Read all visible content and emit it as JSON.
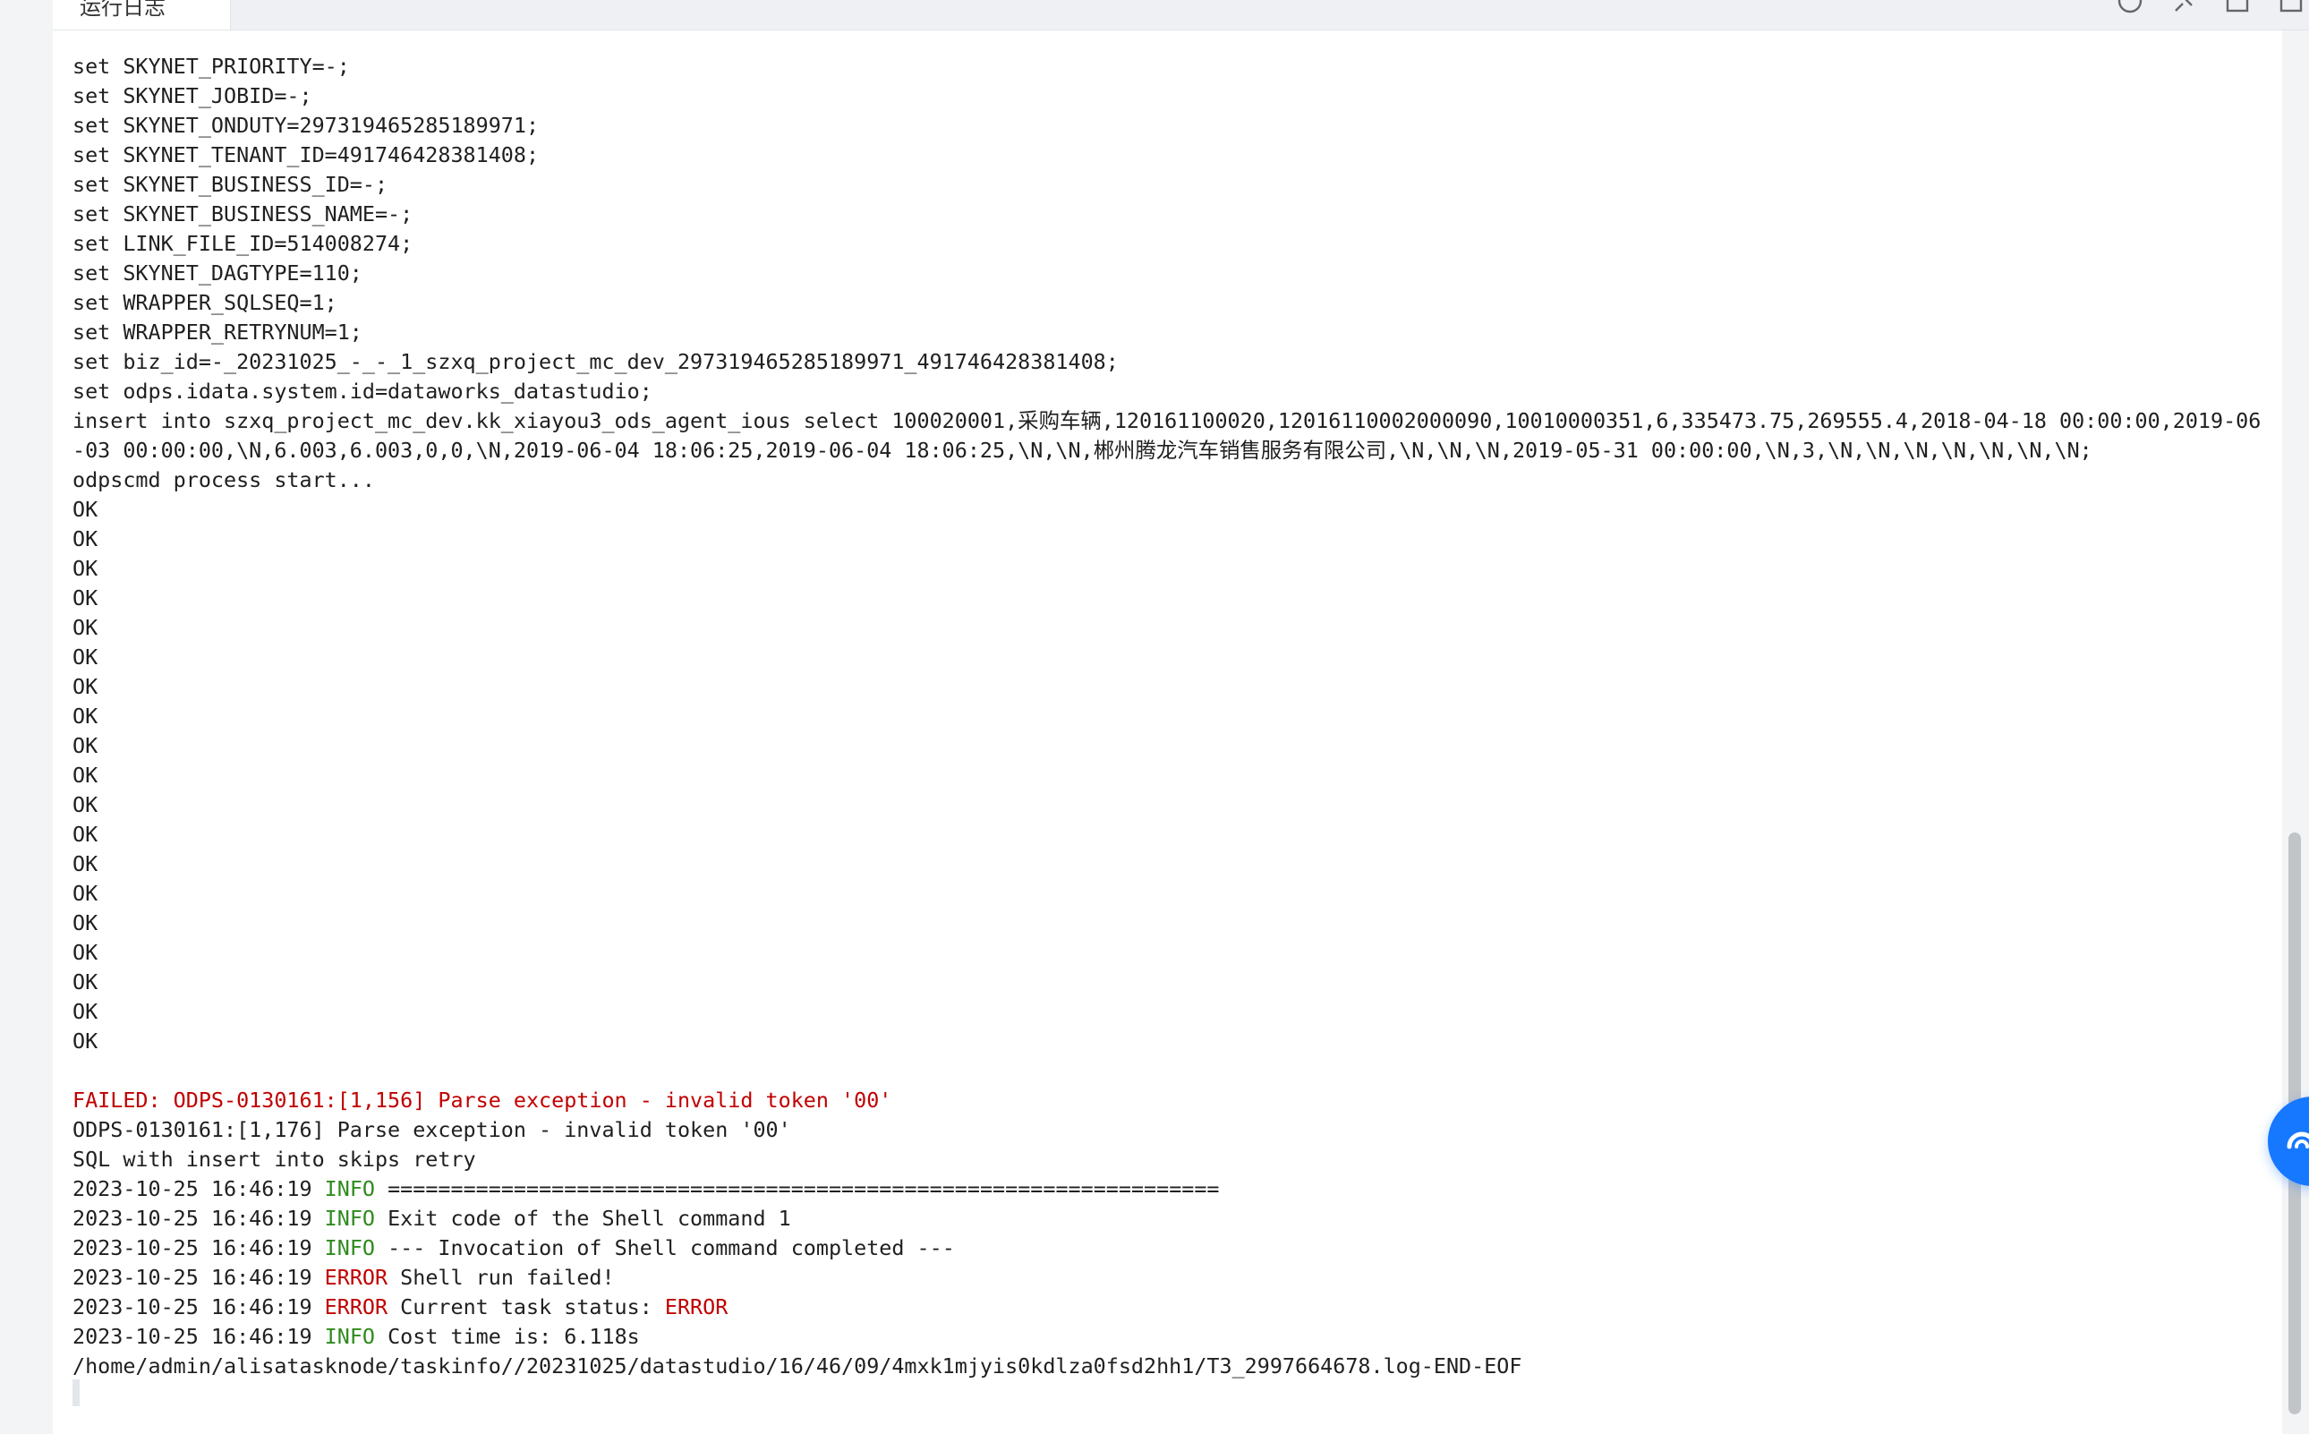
{
  "tab": {
    "label": "运行日志"
  },
  "toolbar": {
    "icons": [
      "refresh-icon",
      "pin-icon",
      "expand-icon",
      "close-icon"
    ]
  },
  "log": {
    "lines": [
      {
        "text": "set SKYNET_PRIORITY=-;"
      },
      {
        "text": "set SKYNET_JOBID=-;"
      },
      {
        "text": "set SKYNET_ONDUTY=297319465285189971;"
      },
      {
        "text": "set SKYNET_TENANT_ID=491746428381408;"
      },
      {
        "text": "set SKYNET_BUSINESS_ID=-;"
      },
      {
        "text": "set SKYNET_BUSINESS_NAME=-;"
      },
      {
        "text": "set LINK_FILE_ID=514008274;"
      },
      {
        "text": "set SKYNET_DAGTYPE=110;"
      },
      {
        "text": "set WRAPPER_SQLSEQ=1;"
      },
      {
        "text": "set WRAPPER_RETRYNUM=1;"
      },
      {
        "text": "set biz_id=-_20231025_-_-_1_szxq_project_mc_dev_297319465285189971_491746428381408;"
      },
      {
        "text": "set odps.idata.system.id=dataworks_datastudio;"
      },
      {
        "text": "insert into szxq_project_mc_dev.kk_xiayou3_ods_agent_ious select 100020001,采购车辆,120161100020,12016110002000090,10010000351,6,335473.75,269555.4,2018-04-18 00:00:00,2019-06-03 00:00:00,\\N,6.003,6.003,0,0,\\N,2019-06-04 18:06:25,2019-06-04 18:06:25,\\N,\\N,郴州腾龙汽车销售服务有限公司,\\N,\\N,\\N,2019-05-31 00:00:00,\\N,3,\\N,\\N,\\N,\\N,\\N,\\N,\\N;"
      },
      {
        "text": "odpscmd process start..."
      },
      {
        "text": "OK"
      },
      {
        "text": "OK"
      },
      {
        "text": "OK"
      },
      {
        "text": "OK"
      },
      {
        "text": "OK"
      },
      {
        "text": "OK"
      },
      {
        "text": "OK"
      },
      {
        "text": "OK"
      },
      {
        "text": "OK"
      },
      {
        "text": "OK"
      },
      {
        "text": "OK"
      },
      {
        "text": "OK"
      },
      {
        "text": "OK"
      },
      {
        "text": "OK"
      },
      {
        "text": "OK"
      },
      {
        "text": "OK"
      },
      {
        "text": "OK"
      },
      {
        "text": "OK"
      },
      {
        "text": "OK"
      },
      {
        "text": ""
      },
      {
        "text": "FAILED: ODPS-0130161:[1,156] Parse exception - invalid token '00'",
        "kind": "failed"
      },
      {
        "text": "ODPS-0130161:[1,176] Parse exception - invalid token '00'"
      },
      {
        "text": "SQL with insert into skips retry"
      },
      {
        "ts": "2023-10-25 16:46:19 ",
        "level": "INFO",
        "msg": " =================================================================="
      },
      {
        "ts": "2023-10-25 16:46:19 ",
        "level": "INFO",
        "msg": " Exit code of the Shell command 1"
      },
      {
        "ts": "2023-10-25 16:46:19 ",
        "level": "INFO",
        "msg": " --- Invocation of Shell command completed ---"
      },
      {
        "ts": "2023-10-25 16:46:19 ",
        "level": "ERROR",
        "msg": " Shell run failed!"
      },
      {
        "ts": "2023-10-25 16:46:19 ",
        "level": "ERROR",
        "msg": " Current task status: ",
        "tail": "ERROR"
      },
      {
        "ts": "2023-10-25 16:46:19 ",
        "level": "INFO",
        "msg": " Cost time is: 6.118s"
      },
      {
        "text": "/home/admin/alisatasknode/taskinfo//20231025/datastudio/16/46/09/4mxk1mjyis0kdlza0fsd2hh1/T3_2997664678.log-END-EOF"
      }
    ]
  },
  "colors": {
    "info": "#2e8b1d",
    "error": "#c00000",
    "float_button": "#1677ff"
  }
}
